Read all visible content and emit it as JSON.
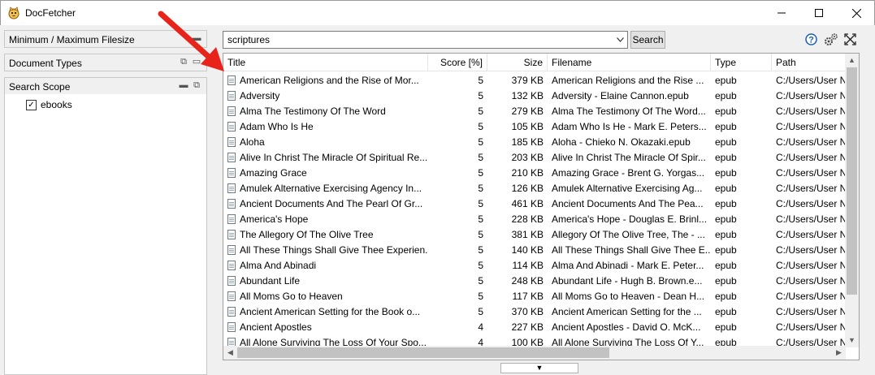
{
  "window": {
    "title": "DocFetcher"
  },
  "sidebar": {
    "panels": [
      {
        "label": "Minimum / Maximum Filesize"
      },
      {
        "label": "Document Types"
      },
      {
        "label": "Search Scope"
      }
    ],
    "scope_items": [
      {
        "label": "ebooks",
        "checked": true
      }
    ]
  },
  "search": {
    "query": "scriptures",
    "button_label": "Search"
  },
  "table": {
    "columns": [
      "Title",
      "Score [%]",
      "Size",
      "Filename",
      "Type",
      "Path"
    ],
    "rows": [
      [
        "American Religions and the Rise of Mor...",
        "5",
        "379 KB",
        "American Religions and the Rise ...",
        "epub",
        "C:/Users/User N"
      ],
      [
        "Adversity",
        "5",
        "132 KB",
        "Adversity - Elaine Cannon.epub",
        "epub",
        "C:/Users/User N"
      ],
      [
        "Alma The Testimony Of The Word",
        "5",
        "279 KB",
        "Alma The Testimony Of The Word...",
        "epub",
        "C:/Users/User N"
      ],
      [
        "Adam Who Is He",
        "5",
        "105 KB",
        "Adam Who Is He - Mark E. Peters...",
        "epub",
        "C:/Users/User N"
      ],
      [
        "Aloha",
        "5",
        "185 KB",
        "Aloha - Chieko N. Okazaki.epub",
        "epub",
        "C:/Users/User N"
      ],
      [
        "Alive In Christ The Miracle Of Spiritual Re...",
        "5",
        "203 KB",
        "Alive In Christ The Miracle Of Spir...",
        "epub",
        "C:/Users/User N"
      ],
      [
        "Amazing Grace",
        "5",
        "210 KB",
        "Amazing Grace - Brent G. Yorgas...",
        "epub",
        "C:/Users/User N"
      ],
      [
        "Amulek Alternative Exercising Agency In...",
        "5",
        "126 KB",
        "Amulek Alternative Exercising Ag...",
        "epub",
        "C:/Users/User N"
      ],
      [
        "Ancient Documents And The Pearl Of Gr...",
        "5",
        "461 KB",
        "Ancient Documents And The Pea...",
        "epub",
        "C:/Users/User N"
      ],
      [
        "America's Hope",
        "5",
        "228 KB",
        "America's Hope - Douglas E. Brinl...",
        "epub",
        "C:/Users/User N"
      ],
      [
        "The Allegory Of The Olive Tree",
        "5",
        "381 KB",
        "Allegory Of The Olive Tree, The - ...",
        "epub",
        "C:/Users/User N"
      ],
      [
        "All These Things Shall Give Thee Experien...",
        "5",
        "140 KB",
        "All These Things Shall Give Thee E...",
        "epub",
        "C:/Users/User N"
      ],
      [
        "Alma And Abinadi",
        "5",
        "114 KB",
        "Alma And Abinadi - Mark E. Peter...",
        "epub",
        "C:/Users/User N"
      ],
      [
        "Abundant Life",
        "5",
        "248 KB",
        "Abundant Life - Hugh B. Brown.e...",
        "epub",
        "C:/Users/User N"
      ],
      [
        "All Moms Go to Heaven",
        "5",
        "117 KB",
        "All Moms Go to Heaven - Dean H...",
        "epub",
        "C:/Users/User N"
      ],
      [
        "Ancient American Setting for the Book o...",
        "5",
        "370 KB",
        "Ancient American Setting for the ...",
        "epub",
        "C:/Users/User N"
      ],
      [
        "Ancient Apostles",
        "4",
        "227 KB",
        "Ancient Apostles - David O. McK...",
        "epub",
        "C:/Users/User N"
      ],
      [
        "All Alone Surviving The Loss Of Your Spo...",
        "4",
        "100 KB",
        "All Alone Surviving The Loss Of Y...",
        "epub",
        "C:/Users/User N"
      ]
    ]
  },
  "colors": {
    "arrow": "#e8231a",
    "accent": "#1a5fb4"
  },
  "icons": {
    "app": "docfetcher-cat-icon",
    "help": "help-icon",
    "settings": "gear-icon",
    "maximize_pane": "expand-icon"
  }
}
